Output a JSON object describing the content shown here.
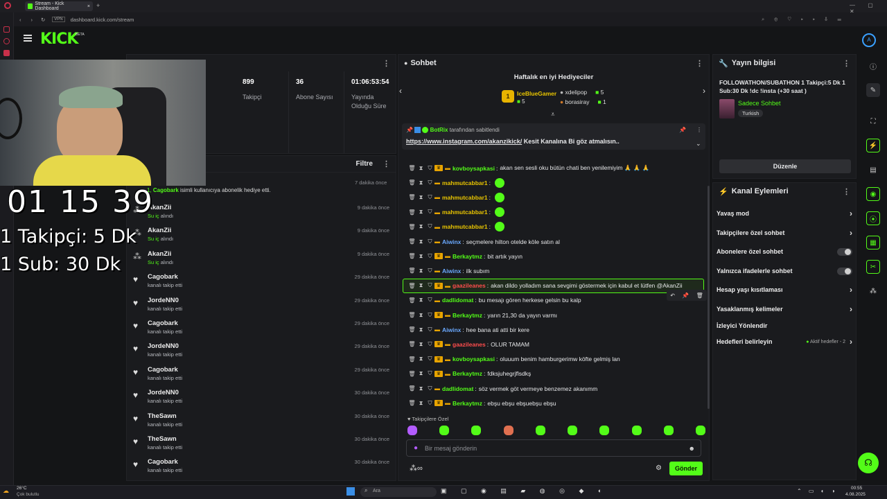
{
  "browser": {
    "tab_title": "Stream - Kick Dashboard",
    "url": "dashboard.kick.com/stream",
    "vpn": "VPN",
    "search_placeholder": "Ara"
  },
  "app": {
    "logo": "KICK",
    "logo_badge": "BETA"
  },
  "stats": [
    {
      "value": "899",
      "label": "Takipçi"
    },
    {
      "value": "36",
      "label": "Abone Sayısı"
    },
    {
      "value": "01:06:53:54",
      "label": "Yayında Olduğu Süre"
    }
  ],
  "activity": {
    "filter_label": "Filtre",
    "gift_line": {
      "prefix": "1,",
      "user": "Cagobark",
      "text": "isimli kullanıcıya abonelik hediye etti.",
      "time": "7 dakika önce"
    },
    "items": [
      {
        "name": "AkanZii",
        "sub": "Su iç",
        "sub_suffix": "alındı",
        "time": "9 dakika önce"
      },
      {
        "name": "AkanZii",
        "sub": "Su iç",
        "sub_suffix": "alındı",
        "time": "9 dakika önce"
      },
      {
        "name": "AkanZii",
        "sub": "Su iç",
        "sub_suffix": "alındı",
        "time": "9 dakika önce"
      },
      {
        "name": "Cagobark",
        "sub": "kanalı takip etti",
        "time": "29 dakika önce"
      },
      {
        "name": "JordeNN0",
        "sub": "kanalı takip etti",
        "time": "29 dakika önce"
      },
      {
        "name": "Cagobark",
        "sub": "kanalı takip etti",
        "time": "29 dakika önce"
      },
      {
        "name": "JordeNN0",
        "sub": "kanalı takip etti",
        "time": "29 dakika önce"
      },
      {
        "name": "Cagobark",
        "sub": "kanalı takip etti",
        "time": "29 dakika önce"
      },
      {
        "name": "JordeNN0",
        "sub": "kanalı takip etti",
        "time": "30 dakika önce"
      },
      {
        "name": "TheSawn",
        "sub": "kanalı takip etti",
        "time": "30 dakika önce"
      },
      {
        "name": "TheSawn",
        "sub": "kanalı takip etti",
        "time": "30 dakika önce"
      },
      {
        "name": "Cagobark",
        "sub": "kanalı takip etti",
        "time": "30 dakika önce"
      }
    ]
  },
  "overlay": {
    "timer": "01 15 39",
    "line1": "1 Takipçi: 5 Dk",
    "line2": "1 Sub: 30 Dk"
  },
  "chat": {
    "title": "Sohbet",
    "gifters_title": "Haftalık en iyi Hediyeciler",
    "gifters": [
      {
        "rank": "1",
        "name": "IceBlueGamer",
        "count": "5"
      },
      {
        "rank": "2",
        "name": "xdelipop",
        "count": "5"
      },
      {
        "rank": "3",
        "name": "borasiray",
        "count": "1"
      }
    ],
    "pinned_by": "BotRix",
    "pinned_suffix": "tarafından sabitlendi",
    "pinned_link": "https://www.instagram.com/akanzikick/",
    "pinned_text": "Kesit Kanalına Bi göz atmalısın..",
    "messages": [
      {
        "user": "kovboysapkasi",
        "color": "#53fc18",
        "text": "akan sen sesli oku bütün chati ben yenilemiyim 🙏 🙏 🙏",
        "crown": true
      },
      {
        "user": "mahmutcabbar1",
        "color": "#e8c400",
        "text": "",
        "emote": true
      },
      {
        "user": "mahmutcabbar1",
        "color": "#e8c400",
        "text": "",
        "emote": true
      },
      {
        "user": "mahmutcabbar1",
        "color": "#e8c400",
        "text": "",
        "emote": true
      },
      {
        "user": "mahmutcabbar1",
        "color": "#e8c400",
        "text": "",
        "emote": true
      },
      {
        "user": "Aiwinx",
        "color": "#6aa9ff",
        "text": "seçmelere hilton otelde köle satın al"
      },
      {
        "user": "Berkaytmz",
        "color": "#53fc18",
        "text": "bit artık yayın",
        "crown": true
      },
      {
        "user": "Aiwinx",
        "color": "#6aa9ff",
        "text": "ilk subım"
      },
      {
        "user": "gaazileanes",
        "color": "#ff4d4d",
        "text": "akan dildo yolladım sana sevgimi göstermek için kabul et lütfen @AkanZii",
        "crown": true
      },
      {
        "user": "dadlidomat",
        "color": "#53fc18",
        "text": "bu mesajı gören herkese gelsin bu kalp"
      },
      {
        "user": "Berkaytmz",
        "color": "#53fc18",
        "text": "yarın 21,30 da yayın varmı",
        "crown": true
      },
      {
        "user": "Aiwinx",
        "color": "#6aa9ff",
        "text": "hee bana ati atti bir kere"
      },
      {
        "user": "gaazileanes",
        "color": "#ff4d4d",
        "text": "OLUR TAMAM",
        "crown": true
      },
      {
        "user": "kovboysapkasi",
        "color": "#53fc18",
        "text": "oluuum benim hamburgerimw köfte gelmiş lan",
        "crown": true
      },
      {
        "user": "Berkaytmz",
        "color": "#53fc18",
        "text": "fdksjuhegrjflsdkş",
        "crown": true
      },
      {
        "user": "dadlidomat",
        "color": "#53fc18",
        "text": "söz vermek göt vermeye benzemez akanımm"
      },
      {
        "user": "Berkaytmz",
        "color": "#53fc18",
        "text": "ebşu ebşu ebşuebşu ebşu",
        "crown": true
      }
    ],
    "emotes_label": "Takipçilere Özel",
    "input_placeholder": "Bir mesaj gönderin",
    "send_label": "Gönder",
    "infinity": "∞"
  },
  "stream_info": {
    "title": "Yayın bilgisi",
    "stream_title": "FOLLOWATHON/SUBATHON 1 Takipçi:5 Dk 1 Sub:30 Dk !dc !insta (+30 saat )",
    "category": "Sadece Sohbet",
    "language": "Turkish",
    "edit_label": "Düzenle"
  },
  "channel_actions": {
    "title": "Kanal Eylemleri",
    "items": [
      {
        "label": "Yavaş mod",
        "kind": "chevron"
      },
      {
        "label": "Takipçilere özel sohbet",
        "kind": "chevron"
      },
      {
        "label": "Abonelere özel sohbet",
        "kind": "toggle"
      },
      {
        "label": "Yalnızca ifadelerle sohbet",
        "kind": "toggle"
      },
      {
        "label": "Hesap yaşı kısıtlaması",
        "kind": "chevron"
      },
      {
        "label": "Yasaklanmış kelimeler",
        "kind": "chevron"
      },
      {
        "label": "İzleyici Yönlendir",
        "kind": "none"
      },
      {
        "label": "Hedefleri belirleyin",
        "kind": "chevron",
        "extra": "Aktif hedefler - 2"
      }
    ]
  },
  "taskbar": {
    "weather_temp": "26°C",
    "weather_text": "Çok bulutlu",
    "time": "00:55",
    "date": "4.08.2025"
  },
  "colors": {
    "accent": "#53fc18",
    "panel": "#1a1b1e",
    "bg": "#141517"
  }
}
